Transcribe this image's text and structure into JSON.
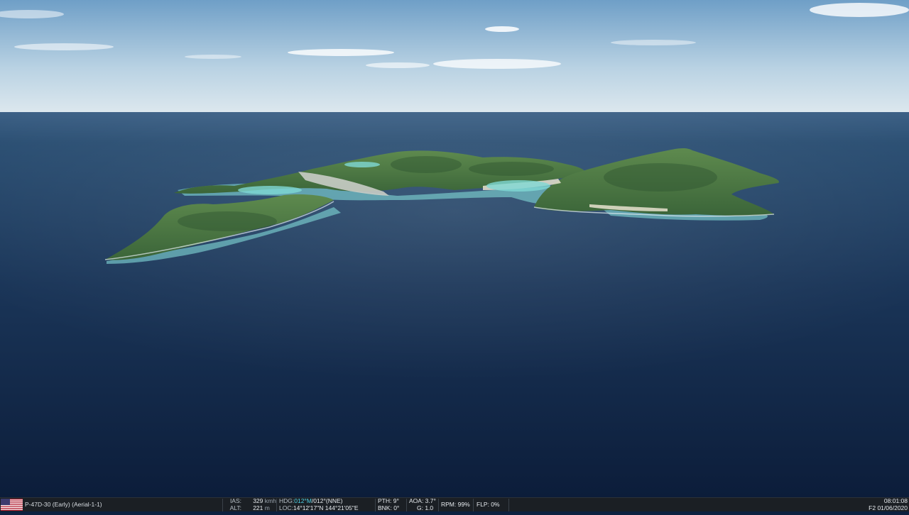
{
  "colors": {
    "sky_top": "#6f9fc7",
    "sky_horizon": "#dde8ee",
    "sea_far": "#2b4f73",
    "sea_near": "#0c1d3a",
    "land": "#4d7a45",
    "shallow_water": "#7ccfd0",
    "hud_bg": "#1b1f24",
    "hud_highlight": "#4fd3e8"
  },
  "scene": {
    "subject": "tropical island seen from the air over open ocean",
    "icons": [
      "us-flag-icon"
    ]
  },
  "hud": {
    "aircraft": "P-47D-30 (Early) (Aerial-1-1)",
    "ias_label": "IAS:",
    "ias_value": "329",
    "ias_unit": "kmh",
    "alt_label": "ALT:",
    "alt_value": "221",
    "alt_unit": "m",
    "hdg_label": "HDG:",
    "hdg_mag": "012°M",
    "hdg_true": "/012°(NNE)",
    "loc_label": "LOC:",
    "loc_value": "14°12'17\"N 144°21'05\"E",
    "pth": "PTH: 9°",
    "bnk": "BNK: 0°",
    "aoa": "AOA: 3.7°",
    "g": "G: 1.0",
    "rpm": "RPM: 99%",
    "flp": "FLP: 0%",
    "time": "08:01:08",
    "date": "F2 01/06/2020"
  }
}
